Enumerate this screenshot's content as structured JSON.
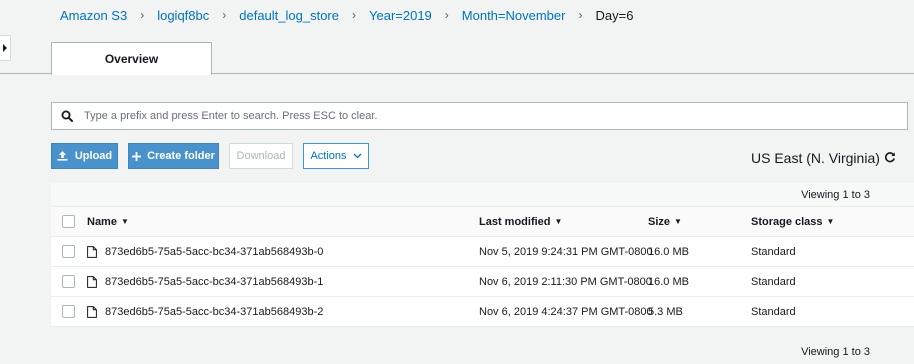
{
  "breadcrumb": {
    "items": [
      "Amazon S3",
      "logiqf8bc",
      "default_log_store",
      "Year=2019",
      "Month=November",
      "Day=6"
    ],
    "separator": "›"
  },
  "tabs": {
    "overview": "Overview"
  },
  "search": {
    "placeholder": "Type a prefix and press Enter to search. Press ESC to clear."
  },
  "toolbar": {
    "upload": "Upload",
    "create_folder": "Create folder",
    "download": "Download",
    "actions": "Actions"
  },
  "region": "US East (N. Virginia)",
  "viewing": "Viewing 1 to 3",
  "table": {
    "headers": {
      "name": "Name",
      "last_modified": "Last modified",
      "size": "Size",
      "storage_class": "Storage class"
    },
    "rows": [
      {
        "name": "873ed6b5-75a5-5acc-bc34-371ab568493b-0",
        "last_modified": "Nov 5, 2019 9:24:31 PM GMT-0800",
        "size": "16.0 MB",
        "storage_class": "Standard"
      },
      {
        "name": "873ed6b5-75a5-5acc-bc34-371ab568493b-1",
        "last_modified": "Nov 6, 2019 2:11:30 PM GMT-0800",
        "size": "16.0 MB",
        "storage_class": "Standard"
      },
      {
        "name": "873ed6b5-75a5-5acc-bc34-371ab568493b-2",
        "last_modified": "Nov 6, 2019 4:24:37 PM GMT-0800",
        "size": "5.3 MB",
        "storage_class": "Standard"
      }
    ]
  },
  "colors": {
    "link": "#0073bb",
    "primary_button": "#4a92cc",
    "border": "#aab7b8"
  },
  "icons": [
    "search-icon",
    "upload-icon",
    "plus-icon",
    "chevron-down-icon",
    "refresh-icon",
    "file-icon",
    "caret-right-icon"
  ]
}
